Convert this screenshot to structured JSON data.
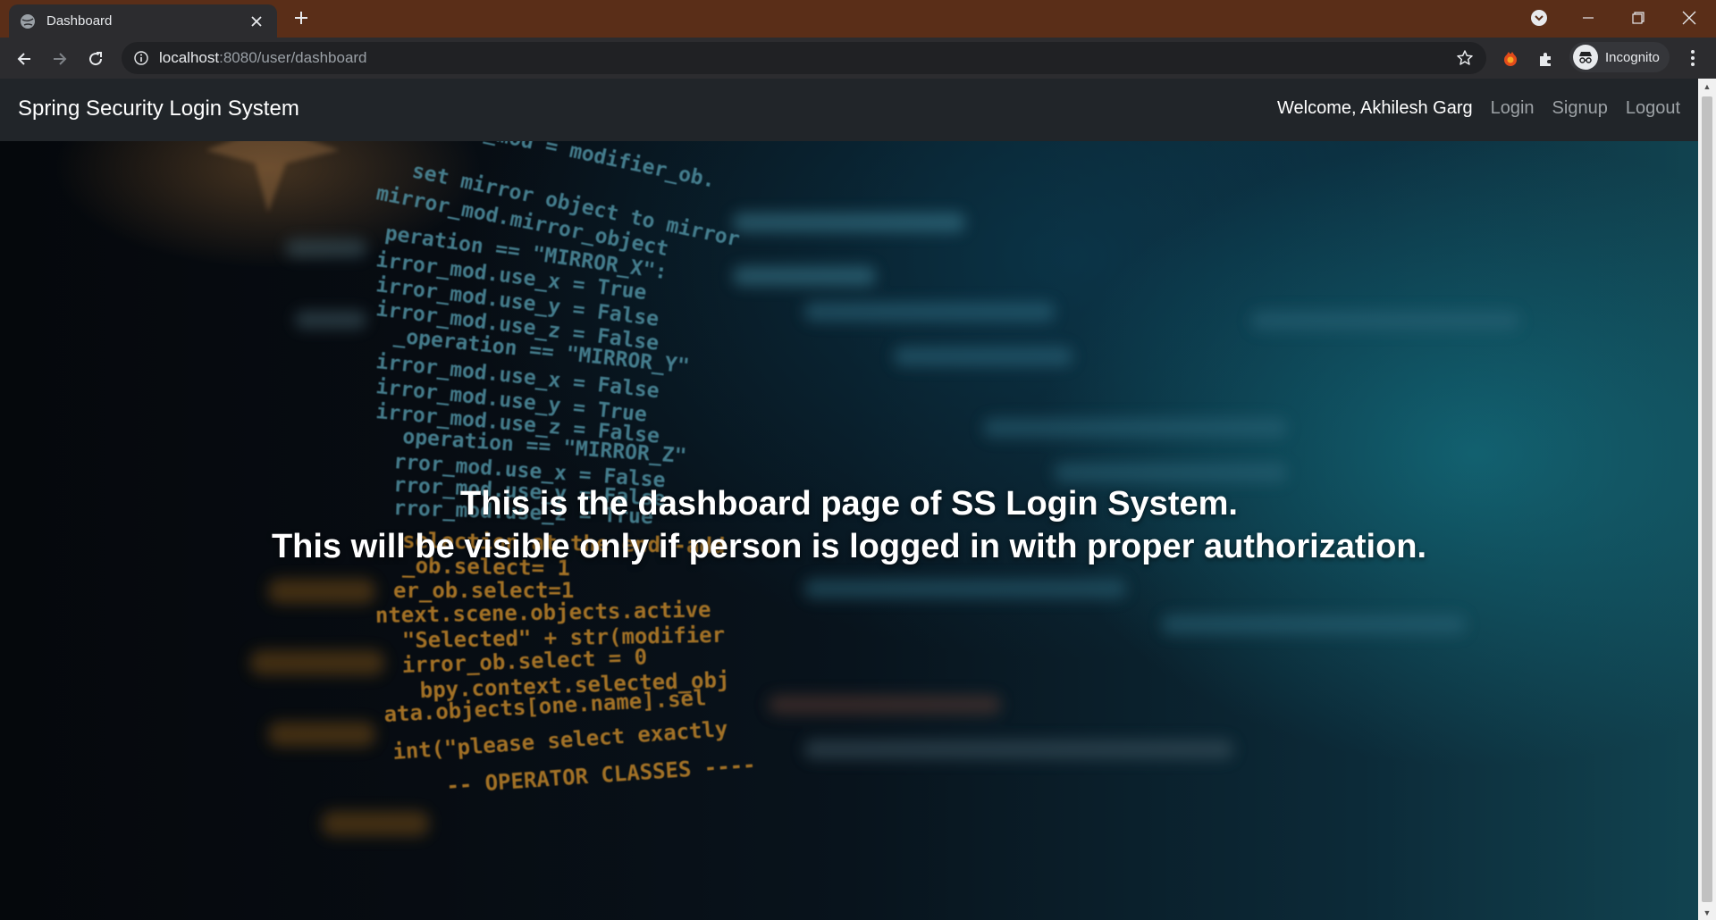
{
  "browser": {
    "tab": {
      "title": "Dashboard"
    },
    "address_bar": {
      "host": "localhost",
      "rest": ":8080/user/dashboard"
    },
    "profile": {
      "label": "Incognito"
    },
    "icons": [
      "globe-icon",
      "close-icon",
      "plus-icon",
      "tab-search-icon",
      "minimize-icon",
      "restore-icon",
      "back-icon",
      "forward-icon",
      "reload-icon",
      "info-icon",
      "star-icon",
      "extension-icon",
      "puzzle-icon",
      "incognito-icon",
      "menu-dots-icon"
    ]
  },
  "site": {
    "brand": "Spring Security Login System",
    "nav": {
      "welcome": "Welcome, Akhilesh Garg",
      "login": "Login",
      "signup": "Signup",
      "logout": "Logout"
    },
    "hero": {
      "line1": "This is the dashboard page of SS Login System.",
      "line2": "This will be visible only if person is logged in with proper authorization."
    }
  },
  "background_code": [
    "mirror_mod = modifier_ob.",
    "set mirror object to mirror",
    "mirror_mod.mirror_object",
    "peration == \"MIRROR_X\":",
    "irror_mod.use_x = True",
    "irror_mod.use_y = False",
    "irror_mod.use_z = False",
    "_operation == \"MIRROR_Y\"",
    "irror_mod.use_x = False",
    "irror_mod.use_y = True",
    "irror_mod.use_z = False",
    "operation == \"MIRROR_Z\"",
    "rror_mod.use_x = False",
    "rror_mod.use_y = False",
    "rror_mod.use_z = True",
    "selection at the end -add",
    "_ob.select= 1",
    "er_ob.select=1",
    "ntext.scene.objects.active",
    "\"Selected\" + str(modifier",
    "irror_ob.select = 0",
    "bpy.context.selected_obj",
    "ata.objects[one.name].sel",
    "int(\"please select exactly",
    "-- OPERATOR CLASSES ----"
  ],
  "colors": {
    "tabstrip": "#5a2e18",
    "toolbar": "#2c2c2f",
    "navbar": "#212529",
    "code_teal": "#4f8fa0",
    "code_orange": "#c98a2a"
  }
}
